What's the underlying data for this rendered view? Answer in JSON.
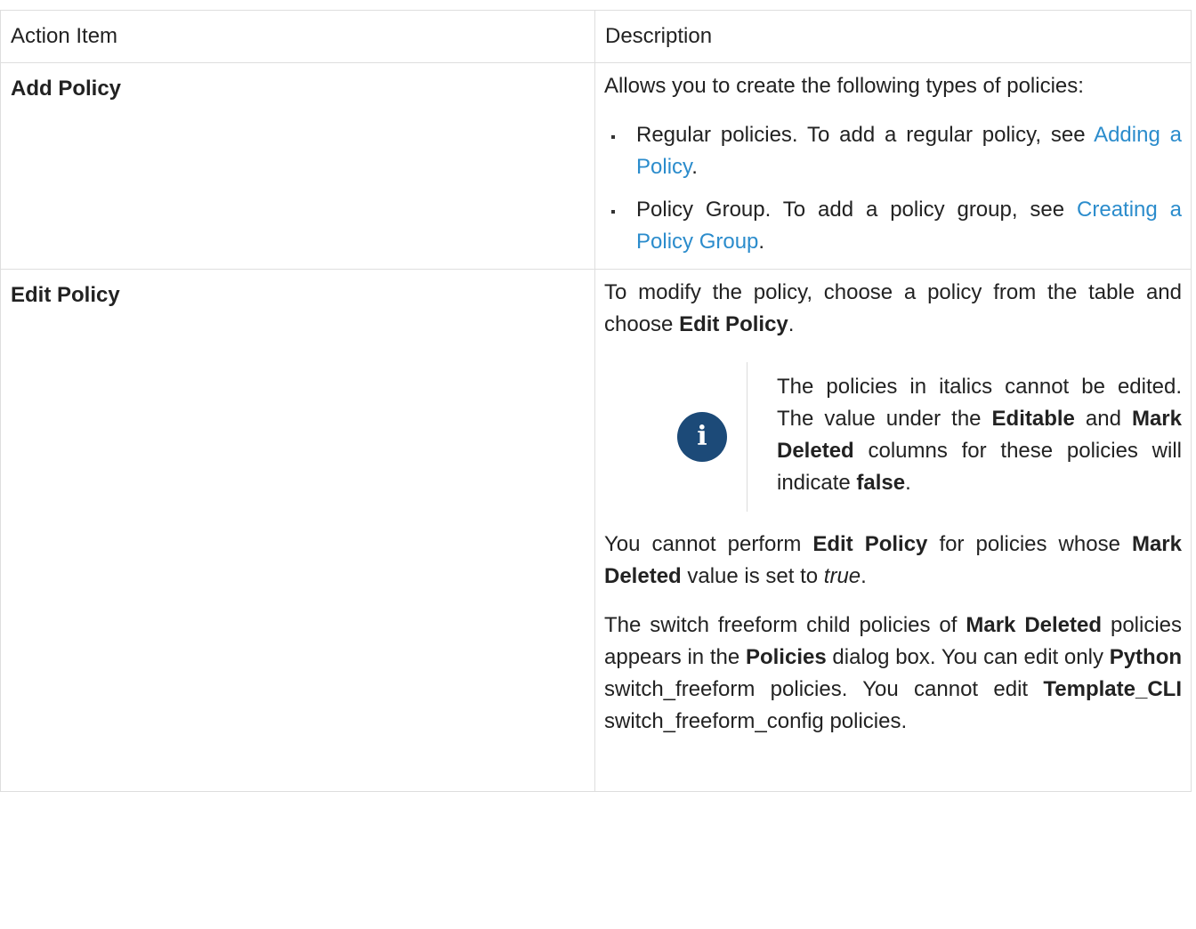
{
  "table": {
    "headers": {
      "action": "Action Item",
      "description": "Description"
    },
    "rows": [
      {
        "action": "Add Policy",
        "intro": "Allows you to create the following types of policies:",
        "bullets": [
          {
            "text": "Regular policies. To add a regular policy, see",
            "link": "Adding a Policy",
            "tail": "."
          },
          {
            "text": "Policy Group. To add a policy group, see",
            "link": "Creating a Policy Group",
            "tail": "."
          }
        ]
      },
      {
        "action": "Edit Policy",
        "p1": {
          "pre": "To modify the policy, choose a policy from the table and choose",
          "bold": "Edit Policy",
          "post": "."
        },
        "note": {
          "icon": "info-icon",
          "glyph": "i",
          "t1": "The policies in italics cannot be edited. The value under the",
          "b1": "Editable",
          "t2": "and",
          "b2": "Mark Deleted",
          "t3": "columns for these policies will indicate",
          "b3": "false",
          "t4": "."
        },
        "p2": {
          "t1": "You cannot perform",
          "b1": "Edit Policy",
          "t2": "for policies whose",
          "b2": "Mark Deleted",
          "t3": "value is set to",
          "i1": "true",
          "t4": "."
        },
        "p3": {
          "t1": "The switch freeform child policies of",
          "b1": "Mark Deleted",
          "t2": "policies appears in the",
          "b2": "Policies",
          "t3": "dialog box. You can edit only",
          "b3": "Python",
          "t4": "switch_freeform policies. You cannot edit",
          "b4": "Template_CLI",
          "t5": "switch_freeform_config policies."
        }
      }
    ]
  }
}
